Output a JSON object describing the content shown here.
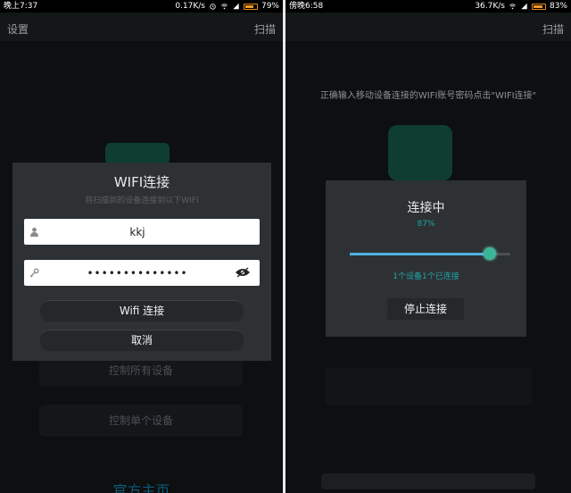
{
  "left": {
    "status": {
      "time": "晚上7:37",
      "speed": "0.17K/s",
      "battery": "79%",
      "battery_level": 0.79
    },
    "titlebar": {
      "settings": "设置",
      "scan": "扫描"
    },
    "background": {
      "control_all": "控制所有设备",
      "control_single": "控制单个设备",
      "official_site": "官方主页"
    },
    "dialog": {
      "title": "WIFI连接",
      "subtitle": "将扫描到的设备连接到以下WIFI",
      "username": "kkj",
      "password": "••••••••••••••",
      "connect": "Wifi 连接",
      "cancel": "取消"
    }
  },
  "right": {
    "status": {
      "time": "傍晚6:58",
      "speed": "36.7K/s",
      "battery": "83%",
      "battery_level": 0.83
    },
    "titlebar": {
      "scan": "扫描"
    },
    "instruction": "正确输入移动设备连接的WIFI账号密码点击\"WIFI连接\"",
    "dialog": {
      "title": "连接中",
      "percent": "87%",
      "progress": 0.87,
      "status": "1个设备1个已连接",
      "stop": "停止连接"
    }
  },
  "colors": {
    "accent_teal": "#1fa3a9",
    "slider_fill": "#4fb1e2",
    "battery": "#f09a2a",
    "dialog_bg": "#2d3133"
  },
  "icons": [
    "alarm-icon",
    "wifi-icon",
    "signal-icon",
    "battery-icon",
    "user-icon",
    "key-icon",
    "eye-icon"
  ]
}
